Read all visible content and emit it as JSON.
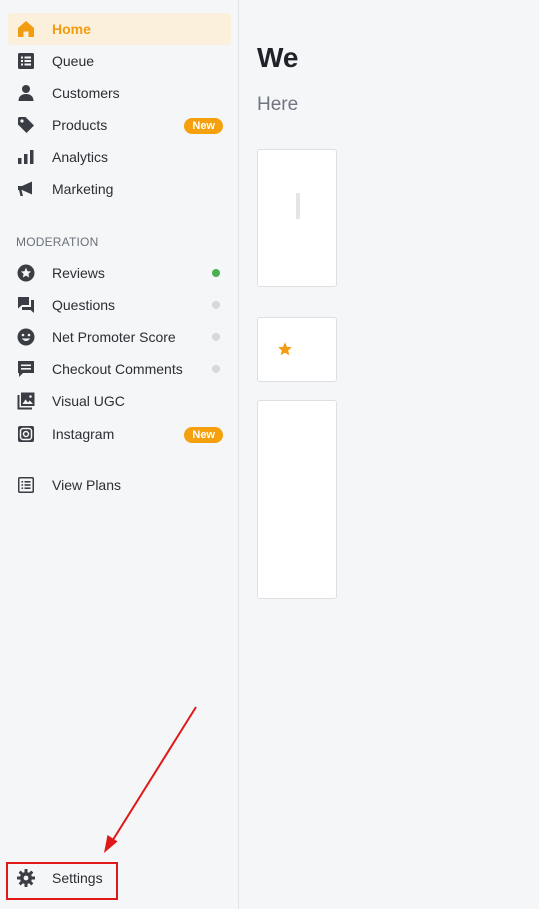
{
  "sidebar": {
    "items": [
      {
        "label": "Home",
        "icon": "home-icon"
      },
      {
        "label": "Queue",
        "icon": "list-icon"
      },
      {
        "label": "Customers",
        "icon": "person-icon"
      },
      {
        "label": "Products",
        "icon": "tag-icon",
        "badge": "New"
      },
      {
        "label": "Analytics",
        "icon": "bar-chart-icon"
      },
      {
        "label": "Marketing",
        "icon": "megaphone-icon"
      }
    ],
    "moderation_heading": "MODERATION",
    "moderation_items": [
      {
        "label": "Reviews",
        "icon": "star-circle-icon",
        "status": "active"
      },
      {
        "label": "Questions",
        "icon": "chat-bubbles-icon",
        "status": "inactive"
      },
      {
        "label": "Net Promoter Score",
        "icon": "smiley-icon",
        "status": "inactive"
      },
      {
        "label": "Checkout Comments",
        "icon": "comment-icon",
        "status": "inactive"
      },
      {
        "label": "Visual UGC",
        "icon": "image-stack-icon"
      },
      {
        "label": "Instagram",
        "icon": "instagram-icon",
        "badge": "New"
      }
    ],
    "view_plans": {
      "label": "View Plans",
      "icon": "plans-list-icon"
    },
    "settings": {
      "label": "Settings",
      "icon": "gear-icon"
    }
  },
  "main": {
    "welcome_title": "We",
    "subtitle": "Here"
  },
  "colors": {
    "accent": "#f39c12",
    "active_bg": "#fbf0dc",
    "badge": "#f5a00f",
    "status_green": "#4caf50",
    "status_gray": "#d6d8db",
    "annotation_red": "#e01818"
  }
}
